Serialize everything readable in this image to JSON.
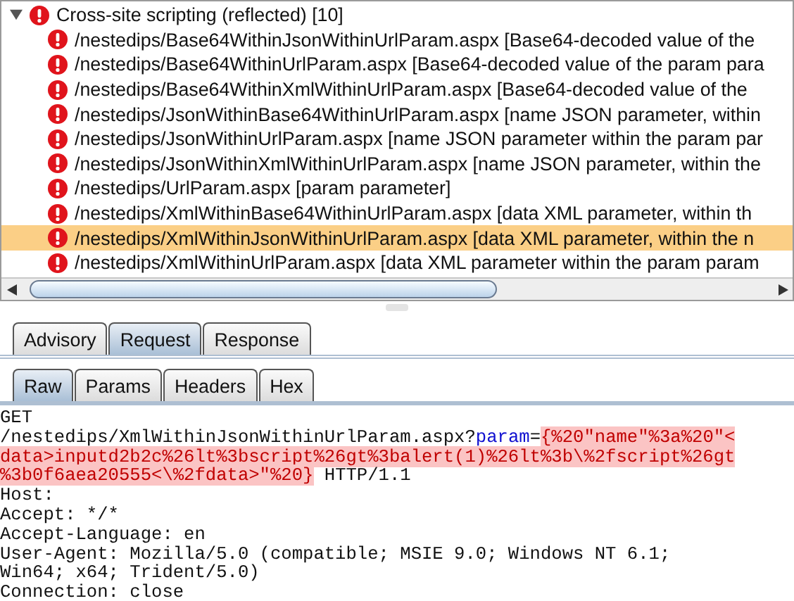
{
  "issue_group": {
    "title": "Cross-site scripting (reflected) [10]",
    "expanded": true,
    "items": [
      {
        "label": "/nestedips/Base64WithinJsonWithinUrlParam.aspx [Base64-decoded value of the",
        "selected": false
      },
      {
        "label": "/nestedips/Base64WithinUrlParam.aspx [Base64-decoded value of the param para",
        "selected": false
      },
      {
        "label": "/nestedips/Base64WithinXmlWithinUrlParam.aspx [Base64-decoded value of the",
        "selected": false
      },
      {
        "label": "/nestedips/JsonWithinBase64WithinUrlParam.aspx [name JSON parameter, within",
        "selected": false
      },
      {
        "label": "/nestedips/JsonWithinUrlParam.aspx [name JSON parameter within the param par",
        "selected": false
      },
      {
        "label": "/nestedips/JsonWithinXmlWithinUrlParam.aspx [name JSON parameter, within the",
        "selected": false
      },
      {
        "label": "/nestedips/UrlParam.aspx [param parameter]",
        "selected": false
      },
      {
        "label": "/nestedips/XmlWithinBase64WithinUrlParam.aspx [data XML parameter, within th",
        "selected": false
      },
      {
        "label": "/nestedips/XmlWithinJsonWithinUrlParam.aspx [data XML parameter, within the n",
        "selected": true
      },
      {
        "label": "/nestedips/XmlWithinUrlParam.aspx [data XML parameter within the param param",
        "selected": false
      }
    ]
  },
  "detail_tabs": [
    {
      "label": "Advisory",
      "selected": false
    },
    {
      "label": "Request",
      "selected": true
    },
    {
      "label": "Response",
      "selected": false
    }
  ],
  "view_tabs": [
    {
      "label": "Raw",
      "selected": true
    },
    {
      "label": "Params",
      "selected": false
    },
    {
      "label": "Headers",
      "selected": false
    },
    {
      "label": "Hex",
      "selected": false
    }
  ],
  "request": {
    "method": "GET",
    "path": "/nestedips/XmlWithinJsonWithinUrlParam.aspx?",
    "param_name": "param",
    "equals": "=",
    "payload_lines": [
      "{%20\"name\"%3a%20\"<",
      "data>inputd2b2c%26lt%3bscript%26gt%3balert(1)%26lt%3b\\%2fscript%26gt",
      "%3b0f6aea20555<\\%2fdata>\"%20}"
    ],
    "protocol": "HTTP/1.1",
    "headers": [
      "Host:",
      "Accept: */*",
      "Accept-Language: en",
      "User-Agent: Mozilla/5.0 (compatible; MSIE 9.0; Windows NT 6.1;",
      "Win64; x64; Trident/5.0)",
      "Connection: close"
    ]
  }
}
